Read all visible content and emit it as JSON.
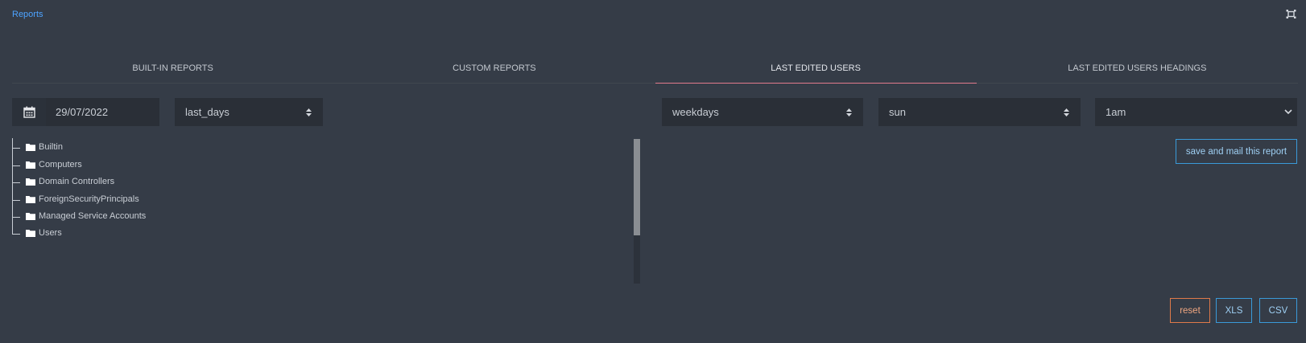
{
  "breadcrumb": "Reports",
  "icons": {
    "fullscreen": "fullscreen-icon",
    "calendar": "calendar-icon",
    "folder": "folder-icon",
    "sort": "sort-icon",
    "chevron": "chevron-down-icon"
  },
  "colors": {
    "background": "#353c47",
    "link": "#4da3ff",
    "active_tab_underline": "#e27a8d",
    "button_border": "#3a9ad9",
    "reset_border": "#e07a4a"
  },
  "tabs": [
    {
      "label": "BUILT-IN REPORTS",
      "active": false
    },
    {
      "label": "CUSTOM REPORTS",
      "active": false
    },
    {
      "label": "LAST EDITED USERS",
      "active": true
    },
    {
      "label": "LAST EDITED USERS HEADINGS",
      "active": false
    }
  ],
  "filters": {
    "date": "29/07/2022",
    "range": "last_days",
    "days": "weekdays",
    "day": "sun",
    "time": "1am"
  },
  "tree": {
    "items": [
      {
        "label": "Builtin"
      },
      {
        "label": "Computers"
      },
      {
        "label": "Domain Controllers"
      },
      {
        "label": "ForeignSecurityPrincipals"
      },
      {
        "label": "Managed Service Accounts"
      },
      {
        "label": "Users"
      }
    ]
  },
  "buttons": {
    "save_mail": "save and mail this report",
    "reset": "reset",
    "xls": "XLS",
    "csv": "CSV"
  }
}
